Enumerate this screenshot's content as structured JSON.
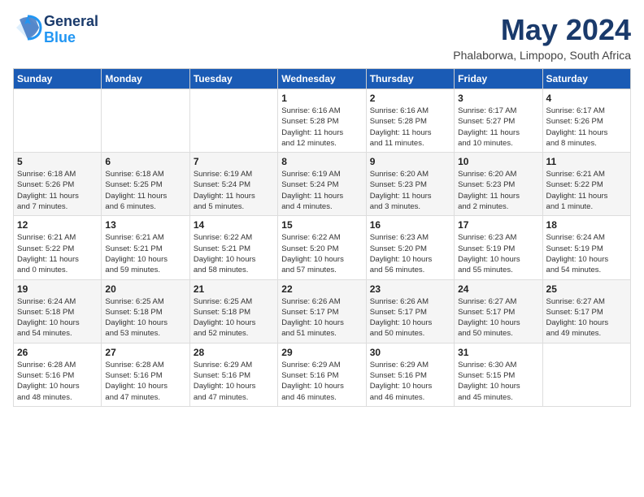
{
  "logo": {
    "line1": "General",
    "line2": "Blue"
  },
  "title": "May 2024",
  "location": "Phalaborwa, Limpopo, South Africa",
  "days_of_week": [
    "Sunday",
    "Monday",
    "Tuesday",
    "Wednesday",
    "Thursday",
    "Friday",
    "Saturday"
  ],
  "weeks": [
    [
      {
        "day": "",
        "info": ""
      },
      {
        "day": "",
        "info": ""
      },
      {
        "day": "",
        "info": ""
      },
      {
        "day": "1",
        "info": "Sunrise: 6:16 AM\nSunset: 5:28 PM\nDaylight: 11 hours\nand 12 minutes."
      },
      {
        "day": "2",
        "info": "Sunrise: 6:16 AM\nSunset: 5:28 PM\nDaylight: 11 hours\nand 11 minutes."
      },
      {
        "day": "3",
        "info": "Sunrise: 6:17 AM\nSunset: 5:27 PM\nDaylight: 11 hours\nand 10 minutes."
      },
      {
        "day": "4",
        "info": "Sunrise: 6:17 AM\nSunset: 5:26 PM\nDaylight: 11 hours\nand 8 minutes."
      }
    ],
    [
      {
        "day": "5",
        "info": "Sunrise: 6:18 AM\nSunset: 5:26 PM\nDaylight: 11 hours\nand 7 minutes."
      },
      {
        "day": "6",
        "info": "Sunrise: 6:18 AM\nSunset: 5:25 PM\nDaylight: 11 hours\nand 6 minutes."
      },
      {
        "day": "7",
        "info": "Sunrise: 6:19 AM\nSunset: 5:24 PM\nDaylight: 11 hours\nand 5 minutes."
      },
      {
        "day": "8",
        "info": "Sunrise: 6:19 AM\nSunset: 5:24 PM\nDaylight: 11 hours\nand 4 minutes."
      },
      {
        "day": "9",
        "info": "Sunrise: 6:20 AM\nSunset: 5:23 PM\nDaylight: 11 hours\nand 3 minutes."
      },
      {
        "day": "10",
        "info": "Sunrise: 6:20 AM\nSunset: 5:23 PM\nDaylight: 11 hours\nand 2 minutes."
      },
      {
        "day": "11",
        "info": "Sunrise: 6:21 AM\nSunset: 5:22 PM\nDaylight: 11 hours\nand 1 minute."
      }
    ],
    [
      {
        "day": "12",
        "info": "Sunrise: 6:21 AM\nSunset: 5:22 PM\nDaylight: 11 hours\nand 0 minutes."
      },
      {
        "day": "13",
        "info": "Sunrise: 6:21 AM\nSunset: 5:21 PM\nDaylight: 10 hours\nand 59 minutes."
      },
      {
        "day": "14",
        "info": "Sunrise: 6:22 AM\nSunset: 5:21 PM\nDaylight: 10 hours\nand 58 minutes."
      },
      {
        "day": "15",
        "info": "Sunrise: 6:22 AM\nSunset: 5:20 PM\nDaylight: 10 hours\nand 57 minutes."
      },
      {
        "day": "16",
        "info": "Sunrise: 6:23 AM\nSunset: 5:20 PM\nDaylight: 10 hours\nand 56 minutes."
      },
      {
        "day": "17",
        "info": "Sunrise: 6:23 AM\nSunset: 5:19 PM\nDaylight: 10 hours\nand 55 minutes."
      },
      {
        "day": "18",
        "info": "Sunrise: 6:24 AM\nSunset: 5:19 PM\nDaylight: 10 hours\nand 54 minutes."
      }
    ],
    [
      {
        "day": "19",
        "info": "Sunrise: 6:24 AM\nSunset: 5:18 PM\nDaylight: 10 hours\nand 54 minutes."
      },
      {
        "day": "20",
        "info": "Sunrise: 6:25 AM\nSunset: 5:18 PM\nDaylight: 10 hours\nand 53 minutes."
      },
      {
        "day": "21",
        "info": "Sunrise: 6:25 AM\nSunset: 5:18 PM\nDaylight: 10 hours\nand 52 minutes."
      },
      {
        "day": "22",
        "info": "Sunrise: 6:26 AM\nSunset: 5:17 PM\nDaylight: 10 hours\nand 51 minutes."
      },
      {
        "day": "23",
        "info": "Sunrise: 6:26 AM\nSunset: 5:17 PM\nDaylight: 10 hours\nand 50 minutes."
      },
      {
        "day": "24",
        "info": "Sunrise: 6:27 AM\nSunset: 5:17 PM\nDaylight: 10 hours\nand 50 minutes."
      },
      {
        "day": "25",
        "info": "Sunrise: 6:27 AM\nSunset: 5:17 PM\nDaylight: 10 hours\nand 49 minutes."
      }
    ],
    [
      {
        "day": "26",
        "info": "Sunrise: 6:28 AM\nSunset: 5:16 PM\nDaylight: 10 hours\nand 48 minutes."
      },
      {
        "day": "27",
        "info": "Sunrise: 6:28 AM\nSunset: 5:16 PM\nDaylight: 10 hours\nand 47 minutes."
      },
      {
        "day": "28",
        "info": "Sunrise: 6:29 AM\nSunset: 5:16 PM\nDaylight: 10 hours\nand 47 minutes."
      },
      {
        "day": "29",
        "info": "Sunrise: 6:29 AM\nSunset: 5:16 PM\nDaylight: 10 hours\nand 46 minutes."
      },
      {
        "day": "30",
        "info": "Sunrise: 6:29 AM\nSunset: 5:16 PM\nDaylight: 10 hours\nand 46 minutes."
      },
      {
        "day": "31",
        "info": "Sunrise: 6:30 AM\nSunset: 5:15 PM\nDaylight: 10 hours\nand 45 minutes."
      },
      {
        "day": "",
        "info": ""
      }
    ]
  ]
}
